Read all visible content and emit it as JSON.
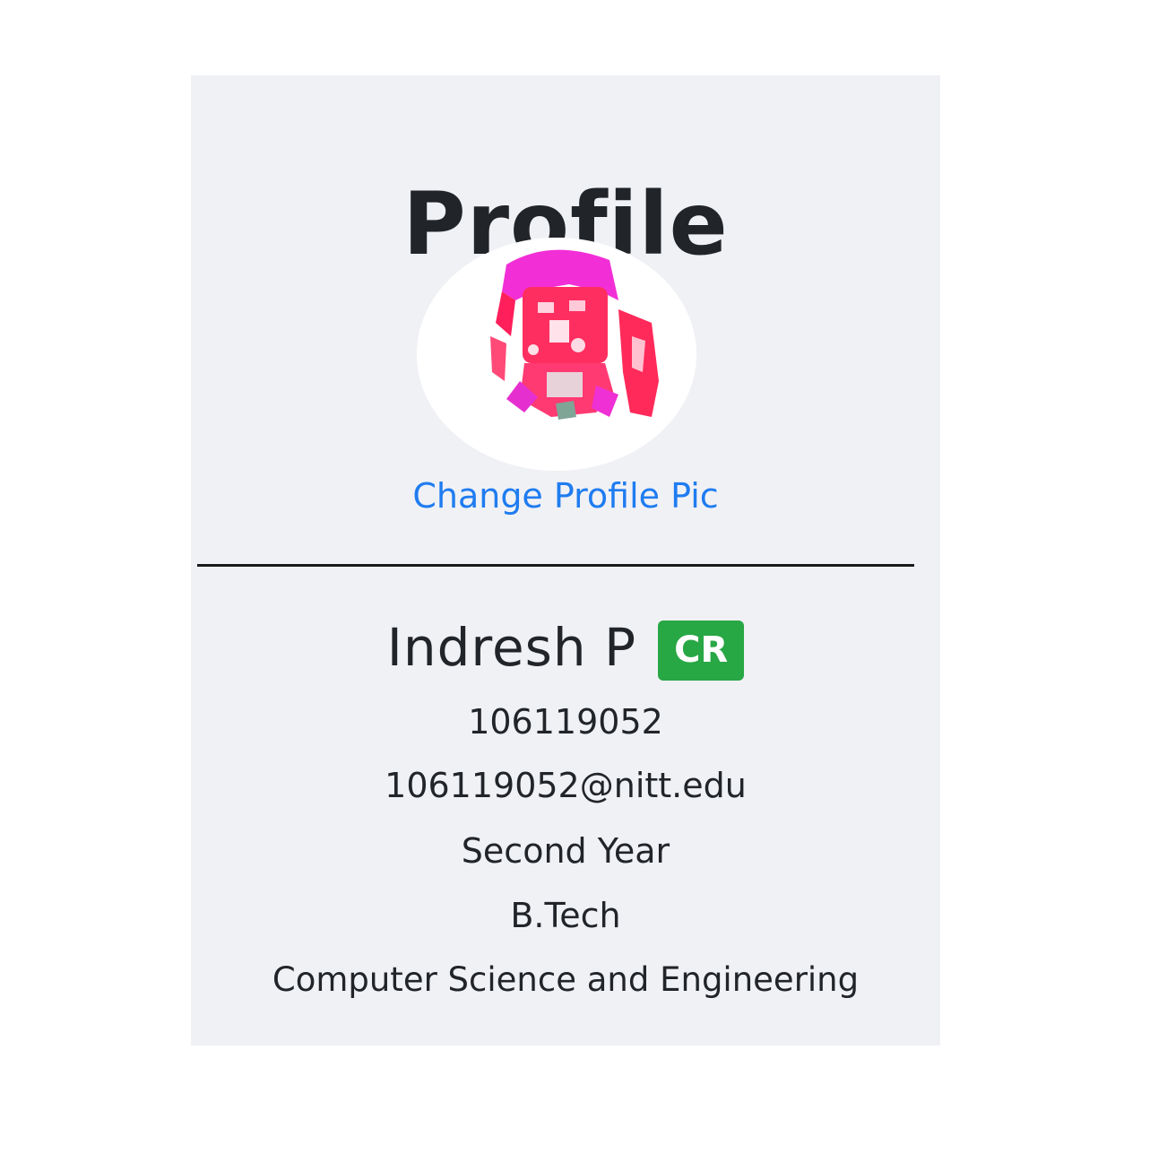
{
  "profile": {
    "title": "Profile",
    "change_pic_label": "Change Profile Pic",
    "name": "Indresh P",
    "badge": "CR",
    "roll_number": "106119052",
    "email": "106119052@nitt.edu",
    "year": "Second Year",
    "degree": "B.Tech",
    "department": "Computer Science and Engineering"
  },
  "colors": {
    "card_background": "#f0f1f5",
    "link": "#1f7cf0",
    "badge": "#28a745",
    "text": "#212529"
  }
}
